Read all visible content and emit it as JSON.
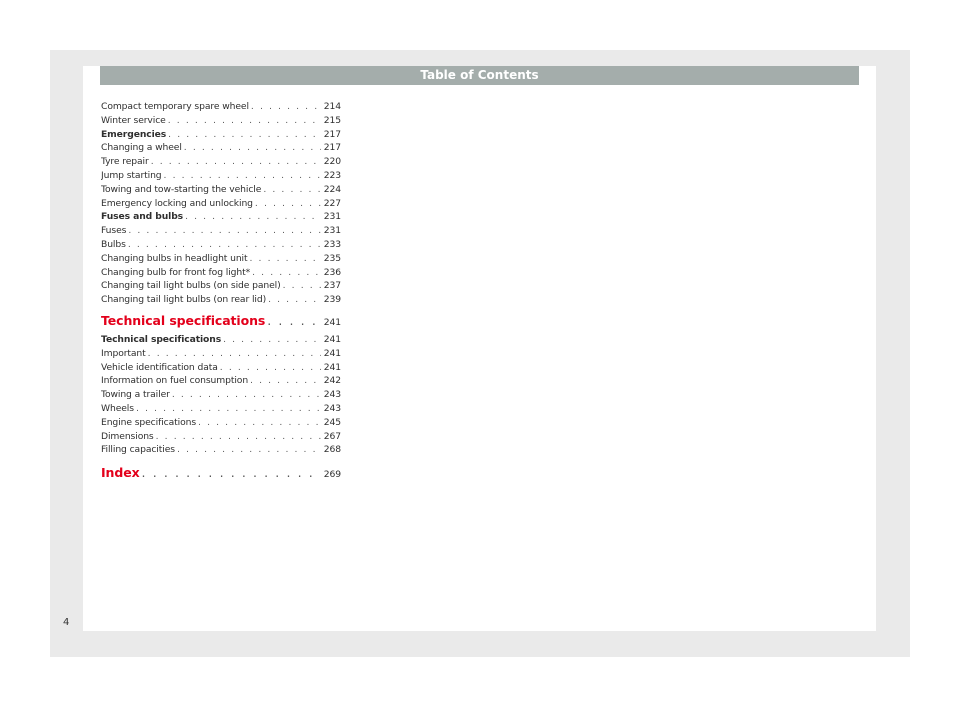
{
  "header": {
    "title": "Table of Contents"
  },
  "toc": [
    {
      "title": "Compact temporary spare wheel",
      "page": "214",
      "style": "normal"
    },
    {
      "title": "Winter service",
      "page": "215",
      "style": "normal"
    },
    {
      "title": "Emergencies",
      "page": "217",
      "style": "bold"
    },
    {
      "title": "Changing a wheel",
      "page": "217",
      "style": "normal"
    },
    {
      "title": "Tyre repair",
      "page": "220",
      "style": "normal"
    },
    {
      "title": "Jump starting",
      "page": "223",
      "style": "normal"
    },
    {
      "title": "Towing and tow-starting the vehicle",
      "page": "224",
      "style": "normal"
    },
    {
      "title": "Emergency locking and unlocking",
      "page": "227",
      "style": "normal"
    },
    {
      "title": "Fuses and bulbs",
      "page": "231",
      "style": "bold"
    },
    {
      "title": "Fuses",
      "page": "231",
      "style": "normal"
    },
    {
      "title": "Bulbs",
      "page": "233",
      "style": "normal"
    },
    {
      "title": "Changing bulbs in headlight unit",
      "page": "235",
      "style": "normal"
    },
    {
      "title": "Changing bulb for front fog light*",
      "page": "236",
      "style": "normal"
    },
    {
      "title": "Changing tail light bulbs (on side panel)",
      "page": "237",
      "style": "normal"
    },
    {
      "title": "Changing tail light bulbs (on rear lid)",
      "page": "239",
      "style": "normal"
    },
    {
      "title": "Technical specifications",
      "page": "241",
      "style": "chapter"
    },
    {
      "title": "Technical specifications",
      "page": "241",
      "style": "bold"
    },
    {
      "title": "Important",
      "page": "241",
      "style": "normal"
    },
    {
      "title": "Vehicle identification data",
      "page": "241",
      "style": "normal"
    },
    {
      "title": "Information on fuel consumption",
      "page": "242",
      "style": "normal"
    },
    {
      "title": "Towing a trailer",
      "page": "243",
      "style": "normal"
    },
    {
      "title": "Wheels",
      "page": "243",
      "style": "normal"
    },
    {
      "title": "Engine specifications",
      "page": "245",
      "style": "normal"
    },
    {
      "title": "Dimensions",
      "page": "267",
      "style": "normal"
    },
    {
      "title": "Filling capacities",
      "page": "268",
      "style": "normal"
    },
    {
      "title": "Index",
      "page": "269",
      "style": "chapter-index"
    }
  ],
  "footer": {
    "page_number": "4"
  },
  "colors": {
    "header_bg": "#a4adab",
    "chapter_red": "#e3001b",
    "frame_gray": "#eaeaea"
  }
}
